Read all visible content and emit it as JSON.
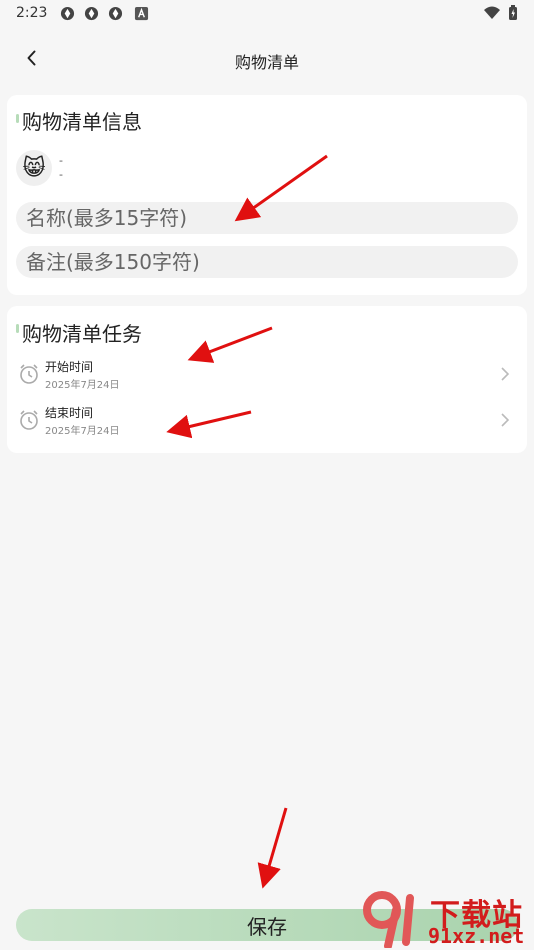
{
  "status_bar": {
    "time": "2:23"
  },
  "header": {
    "title": "购物清单"
  },
  "info_card": {
    "title": "购物清单信息",
    "avatar_emoji": "😸",
    "avatar_line1": "-",
    "avatar_line2": "-",
    "name_placeholder": "名称(最多15字符)",
    "note_placeholder": "备注(最多150字符)"
  },
  "task_card": {
    "title": "购物清单任务",
    "rows": [
      {
        "label": "开始时间",
        "date": "2025年7月24日"
      },
      {
        "label": "结束时间",
        "date": "2025年7月24日"
      }
    ]
  },
  "save_label": "保存",
  "watermark": {
    "text1": "下载站",
    "text2": "91xz.net"
  },
  "colors": {
    "accent": "#a9d3ad",
    "arrow": "#e01010"
  }
}
